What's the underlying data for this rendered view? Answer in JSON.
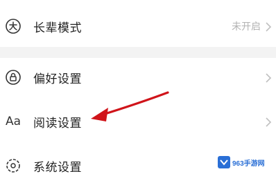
{
  "settings": {
    "elder_mode": {
      "label": "长辈模式",
      "status": "未开启",
      "icon": "elder-mode-icon"
    },
    "preferences": {
      "label": "偏好设置",
      "icon": "lock-icon"
    },
    "reading": {
      "label": "阅读设置",
      "icon_text": "Aa",
      "icon": "font-icon"
    },
    "system": {
      "label": "系统设置",
      "icon": "gear-icon"
    }
  },
  "watermark": {
    "text": "963手游网",
    "icon": "watermark-logo-icon"
  },
  "annotation": {
    "color": "#d0141a",
    "icon": "red-arrow-annotation"
  }
}
